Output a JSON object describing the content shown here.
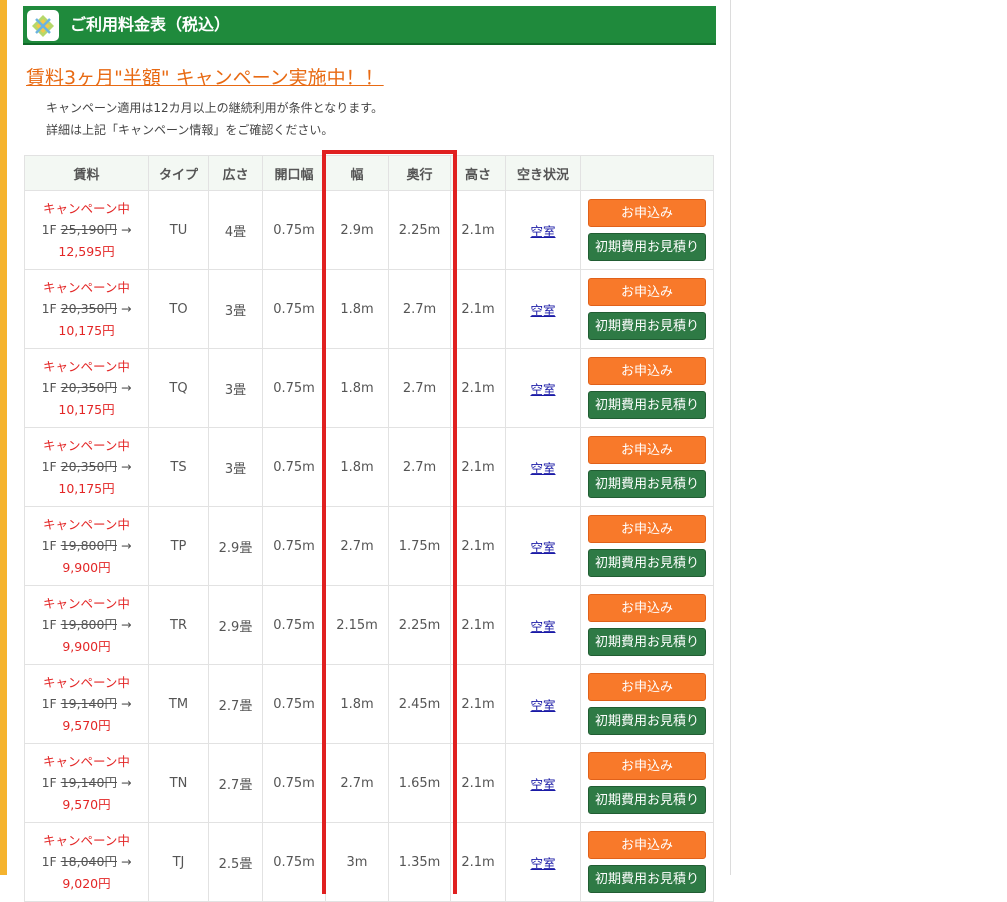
{
  "header": {
    "title": "ご利用料金表（税込）"
  },
  "campaign": {
    "heading": "賃料3ヶ月\"半額\" キャンペーン実施中！！",
    "note1": "キャンペーン適用は12カ月以上の継続利用が条件となります。",
    "note2": "詳細は上記「キャンペーン情報」をご確認ください。"
  },
  "table": {
    "columns": [
      "賃料",
      "タイプ",
      "広さ",
      "開口幅",
      "幅",
      "奥行",
      "高さ",
      "空き状況",
      ""
    ],
    "rows": [
      {
        "campaign": "キャンペーン中",
        "floor": "1F",
        "old_price": "25,190円",
        "arrow": "→",
        "new_price": "12,595円",
        "type": "TU",
        "area": "4畳",
        "opening": "0.75m",
        "width": "2.9m",
        "depth": "2.25m",
        "height": "2.1m",
        "status": "空室",
        "apply": "お申込み",
        "estimate": "初期費用お見積り"
      },
      {
        "campaign": "キャンペーン中",
        "floor": "1F",
        "old_price": "20,350円",
        "arrow": "→",
        "new_price": "10,175円",
        "type": "TO",
        "area": "3畳",
        "opening": "0.75m",
        "width": "1.8m",
        "depth": "2.7m",
        "height": "2.1m",
        "status": "空室",
        "apply": "お申込み",
        "estimate": "初期費用お見積り"
      },
      {
        "campaign": "キャンペーン中",
        "floor": "1F",
        "old_price": "20,350円",
        "arrow": "→",
        "new_price": "10,175円",
        "type": "TQ",
        "area": "3畳",
        "opening": "0.75m",
        "width": "1.8m",
        "depth": "2.7m",
        "height": "2.1m",
        "status": "空室",
        "apply": "お申込み",
        "estimate": "初期費用お見積り"
      },
      {
        "campaign": "キャンペーン中",
        "floor": "1F",
        "old_price": "20,350円",
        "arrow": "→",
        "new_price": "10,175円",
        "type": "TS",
        "area": "3畳",
        "opening": "0.75m",
        "width": "1.8m",
        "depth": "2.7m",
        "height": "2.1m",
        "status": "空室",
        "apply": "お申込み",
        "estimate": "初期費用お見積り"
      },
      {
        "campaign": "キャンペーン中",
        "floor": "1F",
        "old_price": "19,800円",
        "arrow": "→",
        "new_price": "9,900円",
        "type": "TP",
        "area": "2.9畳",
        "opening": "0.75m",
        "width": "2.7m",
        "depth": "1.75m",
        "height": "2.1m",
        "status": "空室",
        "apply": "お申込み",
        "estimate": "初期費用お見積り"
      },
      {
        "campaign": "キャンペーン中",
        "floor": "1F",
        "old_price": "19,800円",
        "arrow": "→",
        "new_price": "9,900円",
        "type": "TR",
        "area": "2.9畳",
        "opening": "0.75m",
        "width": "2.15m",
        "depth": "2.25m",
        "height": "2.1m",
        "status": "空室",
        "apply": "お申込み",
        "estimate": "初期費用お見積り"
      },
      {
        "campaign": "キャンペーン中",
        "floor": "1F",
        "old_price": "19,140円",
        "arrow": "→",
        "new_price": "9,570円",
        "type": "TM",
        "area": "2.7畳",
        "opening": "0.75m",
        "width": "1.8m",
        "depth": "2.45m",
        "height": "2.1m",
        "status": "空室",
        "apply": "お申込み",
        "estimate": "初期費用お見積り"
      },
      {
        "campaign": "キャンペーン中",
        "floor": "1F",
        "old_price": "19,140円",
        "arrow": "→",
        "new_price": "9,570円",
        "type": "TN",
        "area": "2.7畳",
        "opening": "0.75m",
        "width": "2.7m",
        "depth": "1.65m",
        "height": "2.1m",
        "status": "空室",
        "apply": "お申込み",
        "estimate": "初期費用お見積り"
      },
      {
        "campaign": "キャンペーン中",
        "floor": "1F",
        "old_price": "18,040円",
        "arrow": "→",
        "new_price": "9,020円",
        "type": "TJ",
        "area": "2.5畳",
        "opening": "0.75m",
        "width": "3m",
        "depth": "1.35m",
        "height": "2.1m",
        "status": "空室",
        "apply": "お申込み",
        "estimate": "初期費用お見積り"
      }
    ]
  },
  "colors": {
    "header_green": "#1f8a3c",
    "campaign_orange": "#e86a13",
    "price_red": "#e32626",
    "apply_button": "#f8792a",
    "estimate_button": "#2e7a45",
    "highlight": "#e02020"
  },
  "icons": {
    "header_logo": "storage-logo-icon"
  }
}
